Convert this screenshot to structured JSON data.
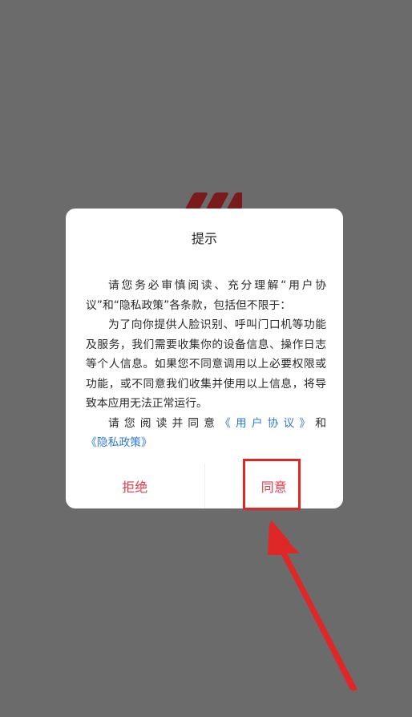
{
  "dialog": {
    "title": "提示",
    "body": {
      "p1": "请您务必审慎阅读、充分理解“用户协议”和“隐私政策”各条款，包括但不限于：",
      "p2": "为了向你提供人脸识别、呼叫门口机等功能及服务，我们需要收集你的设备信息、操作日志等个人信息。如果您不同意调用以上必要权限或功能，或不同意我们收集并使用以上信息，将导致本应用无法正常运行。",
      "p3_prefix": "请您阅读并同意",
      "user_agreement_link": "《用户协议》",
      "and": "和",
      "privacy_policy_link": "《隐私政策》"
    },
    "buttons": {
      "reject_label": "拒绝",
      "agree_label": "同意"
    }
  },
  "colors": {
    "backdrop": "#6b6b6b",
    "dialog_bg": "#ffffff",
    "button_text": "#e8394a",
    "link": "#2f7bd6",
    "annotation": "#e02727",
    "logo": "#7a1a1c"
  },
  "icons": {
    "logo": "app-logo-partial",
    "annotation": "red-arrow-pointing-to-agree"
  }
}
